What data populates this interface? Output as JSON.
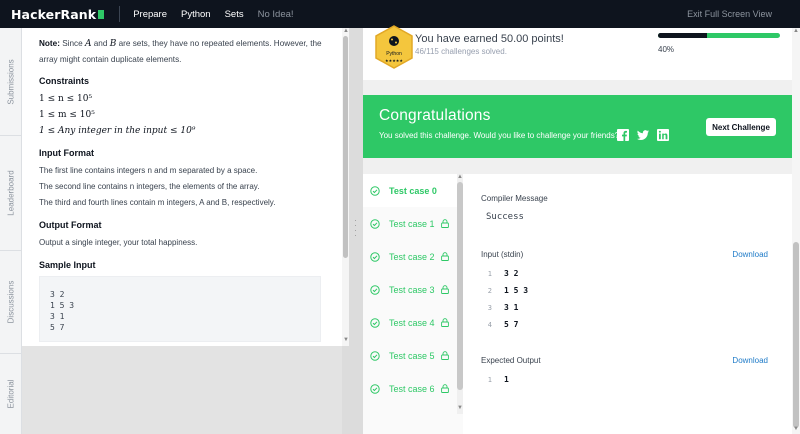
{
  "topbar": {
    "logo": "HackerRank",
    "breadcrumbs": [
      "Prepare",
      "Python",
      "Sets",
      "No Idea!"
    ],
    "exit_label": "Exit Full Screen View"
  },
  "side_tabs": [
    "Submissions",
    "Leaderboard",
    "Discussions",
    "Editorial"
  ],
  "problem": {
    "note_label": "Note:",
    "note_text_1": "Since",
    "var_a": "A",
    "note_and": "and",
    "var_b": "B",
    "note_text_2": "are sets, they have no repeated elements. However, the array might contain duplicate elements.",
    "constraints_heading": "Constraints",
    "constraints": [
      "1 ≤ n ≤ 10⁵",
      "1 ≤ m ≤ 10⁵",
      "1 ≤ Any integer in the input ≤ 10⁹"
    ],
    "input_heading": "Input Format",
    "input_lines": [
      "The first line contains integers n and m separated by a space.",
      "The second line contains n integers, the elements of the array.",
      "The third and fourth lines contain m integers, A and B, respectively."
    ],
    "output_heading": "Output Format",
    "output_text": "Output a single integer, your total happiness.",
    "sample_heading": "Sample Input",
    "sample_input": "3 2\n1 5 3\n3 1\n5 7"
  },
  "points": {
    "badge_label": "Python",
    "earned": "You have earned 50.00 points!",
    "solved": "46/115 challenges solved.",
    "progress_fraction": 0.4,
    "progress_label": "40%"
  },
  "congrats": {
    "title": "Congratulations",
    "subtitle": "You solved this challenge. Would you like to challenge your friends?",
    "next_button": "Next Challenge"
  },
  "test_cases": [
    "Test case 0",
    "Test case 1",
    "Test case 2",
    "Test case 3",
    "Test case 4",
    "Test case 5",
    "Test case 6"
  ],
  "result": {
    "compiler_label": "Compiler Message",
    "compiler_message": "Success",
    "input_label": "Input (stdin)",
    "download_label": "Download",
    "input_lines": [
      "3 2",
      "1 5 3",
      "3 1",
      "5 7"
    ],
    "expected_label": "Expected Output",
    "expected_lines": [
      "1"
    ]
  },
  "colors": {
    "brand_green": "#2ec866",
    "topbar_bg": "#0e141e",
    "link_blue": "#1f7bc8"
  }
}
